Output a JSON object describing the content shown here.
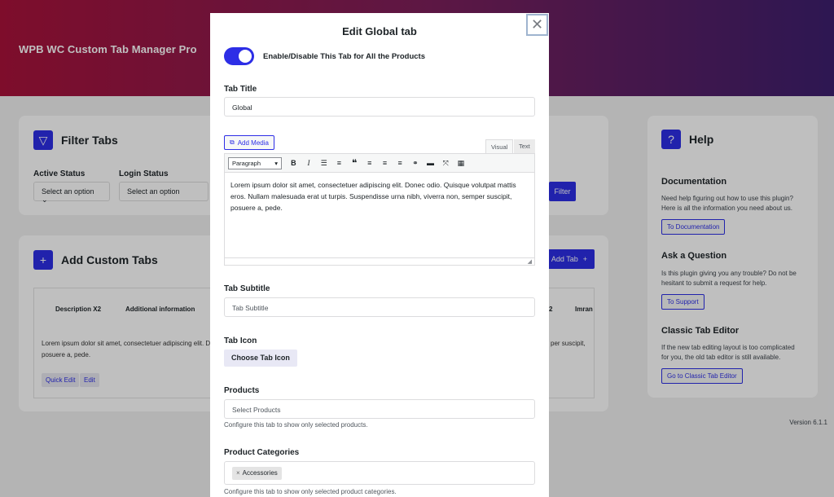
{
  "background": {
    "app_title": "WPB WC Custom Tab Manager Pro",
    "filter": {
      "title": "Filter Tabs",
      "active_status_label": "Active Status",
      "login_status_label": "Login Status",
      "select_placeholder": "Select an option",
      "select_placeholder_2": "Select an option",
      "filter_button": "Filter"
    },
    "custom_tabs": {
      "title": "Add Custom Tabs",
      "add_tab_button": "Add Tab",
      "columns": [
        "Description X2",
        "Additional information"
      ],
      "columns_right": [
        "2",
        "Imran"
      ],
      "row_text": "Lorem ipsum dolor sit amet, consectetuer adipiscing elit. D",
      "row_text_2": "posuere a, pede.",
      "row_text_right": "per suscipit,",
      "quick_edit": "Quick Edit",
      "edit": "Edit"
    },
    "help": {
      "title": "Help",
      "documentation_title": "Documentation",
      "documentation_text": "Need help figuring out how to use this plugin? Here is all the information you need about us.",
      "documentation_button": "To Documentation",
      "ask_title": "Ask a Question",
      "ask_text": "Is this plugin giving you any trouble? Do not be hesitant to submit a request for help.",
      "ask_button": "To Support",
      "classic_title": "Classic Tab Editor",
      "classic_text": "If the new tab editing layout is too complicated for you, the old tab editor is still available.",
      "classic_button": "Go to Classic Tab Editor"
    },
    "version": "Version 6.1.1"
  },
  "modal": {
    "title": "Edit Global tab",
    "toggle_label": "Enable/Disable This Tab for All the Products",
    "toggle_on": true,
    "tab_title_label": "Tab Title",
    "tab_title_value": "Global",
    "add_media": "Add Media",
    "editor_tab_visual": "Visual",
    "editor_tab_text": "Text",
    "paragraph_select": "Paragraph",
    "editor_content": "Lorem ipsum dolor sit amet, consectetuer adipiscing elit. Donec odio. Quisque volutpat mattis eros. Nullam malesuada erat ut turpis. Suspendisse urna nibh, viverra non, semper suscipit, posuere a, pede.",
    "tab_subtitle_label": "Tab Subtitle",
    "tab_subtitle_placeholder": "Tab Subtitle",
    "tab_icon_label": "Tab Icon",
    "choose_icon_button": "Choose Tab Icon",
    "products_label": "Products",
    "products_placeholder": "Select Products",
    "products_help": "Configure this tab to show only selected products.",
    "categories_label": "Product Categories",
    "categories_selected": "Accessories",
    "categories_help": "Configure this tab to show only selected product categories."
  },
  "colors": {
    "accent": "#2d2ee6",
    "hero_start": "#a8123a",
    "hero_end": "#3d1f6e"
  }
}
